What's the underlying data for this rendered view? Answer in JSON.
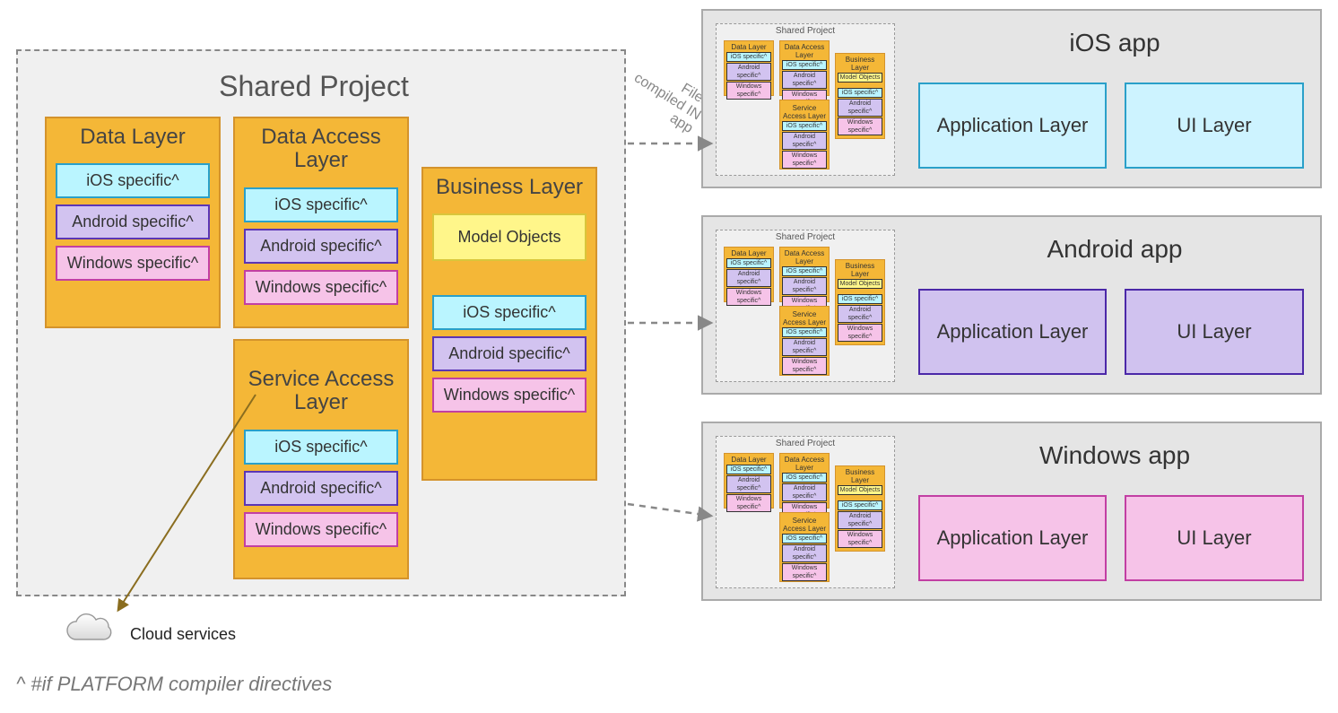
{
  "shared": {
    "title": "Shared Project",
    "layers": {
      "data": {
        "title": "Data Layer",
        "ios": "iOS specific^",
        "android": "Android specific^",
        "windows": "Windows specific^"
      },
      "access": {
        "title": "Data Access Layer",
        "ios": "iOS specific^",
        "android": "Android specific^",
        "windows": "Windows specific^"
      },
      "service": {
        "title": "Service Access Layer",
        "ios": "iOS specific^",
        "android": "Android specific^",
        "windows": "Windows specific^"
      },
      "business": {
        "title": "Business Layer",
        "model": "Model Objects",
        "ios": "iOS specific^",
        "android": "Android specific^",
        "windows": "Windows specific^"
      }
    }
  },
  "apps": {
    "ios": {
      "title": "iOS app",
      "app_layer": "Application Layer",
      "ui_layer": "UI Layer"
    },
    "android": {
      "title": "Android app",
      "app_layer": "Application Layer",
      "ui_layer": "UI Layer"
    },
    "windows": {
      "title": "Windows app",
      "app_layer": "Application Layer",
      "ui_layer": "UI Layer"
    }
  },
  "mini": {
    "title": "Shared Project",
    "data": "Data Layer",
    "access": "Data Access Layer",
    "service": "Service Access Layer",
    "business": "Business Layer",
    "model": "Model Objects",
    "ios": "iOS specific^",
    "android": "Android specific^",
    "windows": "Windows specific^"
  },
  "annotations": {
    "files_note": "Files compiled IN app",
    "cloud": "Cloud services",
    "footnote": "^ #if PLATFORM compiler directives"
  },
  "colors": {
    "layer_fill": "#f4b737",
    "layer_border": "#d4932c",
    "ios_fill": "#baf5ff",
    "ios_border": "#2aa0c9",
    "android_fill": "#d2c3f0",
    "android_border": "#5b36b5",
    "windows_fill": "#f6c3e8",
    "windows_border": "#c23fa3",
    "model_fill": "#fff68a",
    "model_border": "#d9c63b",
    "panel_fill": "#e5e5e5",
    "panel_border": "#aaaaaa",
    "arrow_solid": "#8a6d1f",
    "arrow_dash": "#888888"
  }
}
